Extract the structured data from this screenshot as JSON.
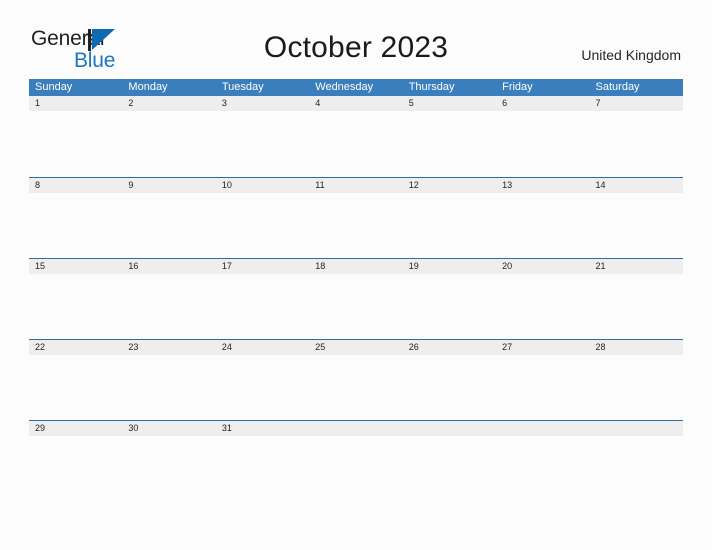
{
  "brand": {
    "name_top": "General",
    "name_bottom": "Blue",
    "mark": "blue-flag-triangle",
    "accent_color": "#1b77c4",
    "dark_color": "#231f20"
  },
  "header": {
    "title": "October 2023",
    "country": "United Kingdom"
  },
  "colors": {
    "header_blue": "#3a7ebd",
    "row_border_blue": "#2e6da4",
    "daynum_band_gray": "#eeeeee",
    "page_background": "#fcfcfd"
  },
  "calendar": {
    "month": "October",
    "year": "2023",
    "weekdays": [
      "Sunday",
      "Monday",
      "Tuesday",
      "Wednesday",
      "Thursday",
      "Friday",
      "Saturday"
    ],
    "weeks": [
      [
        "1",
        "2",
        "3",
        "4",
        "5",
        "6",
        "7"
      ],
      [
        "8",
        "9",
        "10",
        "11",
        "12",
        "13",
        "14"
      ],
      [
        "15",
        "16",
        "17",
        "18",
        "19",
        "20",
        "21"
      ],
      [
        "22",
        "23",
        "24",
        "25",
        "26",
        "27",
        "28"
      ],
      [
        "29",
        "30",
        "31",
        "",
        "",
        "",
        ""
      ]
    ]
  }
}
